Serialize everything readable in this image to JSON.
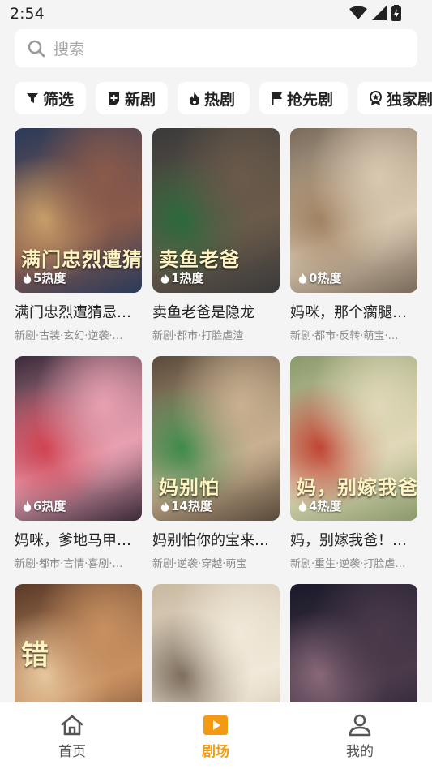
{
  "status_bar": {
    "time": "2:54"
  },
  "search": {
    "placeholder": "搜索"
  },
  "filters": [
    {
      "label": "筛选",
      "icon": "filter-icon"
    },
    {
      "label": "新剧",
      "icon": "new-badge-icon"
    },
    {
      "label": "热剧",
      "icon": "flame-icon"
    },
    {
      "label": "抢先剧",
      "icon": "flag-icon"
    },
    {
      "label": "独家剧",
      "icon": "award-icon"
    }
  ],
  "dramas": [
    {
      "title": "满门忠烈遭猜忌…",
      "tags": "新剧·古装·玄幻·逆袭·…",
      "heat": "5热度",
      "poster_text": "满门忠烈遭猜忌",
      "colors": [
        "#2a3a5a",
        "#8a5a4a",
        "#c9a06a"
      ]
    },
    {
      "title": "卖鱼老爸是隐龙",
      "tags": "新剧·都市·打脸虐渣",
      "heat": "1热度",
      "poster_text": "卖鱼老爸",
      "colors": [
        "#3a3a3a",
        "#6a5a4a",
        "#2a6a3a"
      ]
    },
    {
      "title": "妈咪，那个瘸腿…",
      "tags": "新剧·都市·反转·萌宝·…",
      "heat": "0热度",
      "poster_text": "",
      "colors": [
        "#7a6a5a",
        "#d8c8b0",
        "#a08060"
      ]
    },
    {
      "title": "妈咪，爹地马甲…",
      "tags": "新剧·都市·言情·喜剧·…",
      "heat": "6热度",
      "poster_text": "",
      "colors": [
        "#3a2a3a",
        "#e8a0b0",
        "#d04050"
      ]
    },
    {
      "title": "妈别怕你的宝来…",
      "tags": "新剧·逆袭·穿越·萌宝",
      "heat": "14热度",
      "poster_text": "妈别怕",
      "colors": [
        "#5a4a3a",
        "#c8b090",
        "#3a8a4a"
      ]
    },
    {
      "title": "妈，别嫁我爸！…",
      "tags": "新剧·重生·逆袭·打脸虐…",
      "heat": "4热度",
      "poster_text": "妈，别嫁我爸",
      "colors": [
        "#8a9a6a",
        "#e0d8b8",
        "#c04030"
      ]
    },
    {
      "title": "",
      "tags": "",
      "heat": "",
      "poster_text": "错",
      "colors": [
        "#5a3a2a",
        "#c89060",
        "#e8c8a0"
      ]
    },
    {
      "title": "",
      "tags": "",
      "heat": "",
      "poster_text": "",
      "colors": [
        "#c8b8a0",
        "#f0e8d8",
        "#7a6a5a"
      ]
    },
    {
      "title": "",
      "tags": "",
      "heat": "",
      "poster_text": "",
      "colors": [
        "#1a1a2a",
        "#4a3a4a",
        "#8a6a7a"
      ]
    }
  ],
  "tabbar": [
    {
      "label": "首页",
      "icon": "home-icon"
    },
    {
      "label": "剧场",
      "icon": "theater-play-icon"
    },
    {
      "label": "我的",
      "icon": "profile-icon"
    }
  ],
  "colors": {
    "accent": "#f39a12",
    "background": "#f4f4f4",
    "card": "#ffffff"
  }
}
